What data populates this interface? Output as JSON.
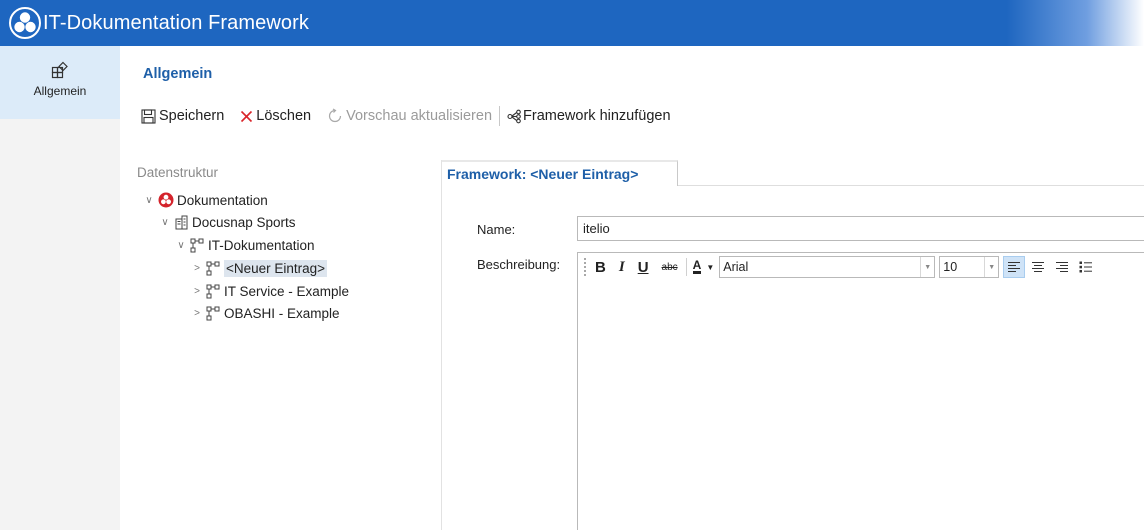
{
  "window": {
    "title": "IT-Dokumentation Framework"
  },
  "rail": {
    "items": [
      {
        "label": "Allgemein",
        "icon": "grid-plus-icon"
      }
    ]
  },
  "page": {
    "title": "Allgemein"
  },
  "toolbar": {
    "save_label": "Speichern",
    "delete_label": "Löschen",
    "refresh_preview_label": "Vorschau aktualisieren",
    "add_framework_label": "Framework hinzufügen"
  },
  "tree": {
    "header": "Datenstruktur",
    "root": "Dokumentation",
    "company": "Docusnap Sports",
    "folder": "IT-Dokumentation",
    "items": [
      "<Neuer Eintrag>",
      "IT Service - Example",
      "OBASHI - Example"
    ]
  },
  "tab": {
    "prefix": "Framework:",
    "name": "<Neuer Eintrag>"
  },
  "form": {
    "name_label": "Name:",
    "name_value": "itelio",
    "description_label": "Beschreibung:"
  },
  "editor": {
    "bold": "B",
    "italic": "I",
    "underline": "U",
    "strike": "abc",
    "font_color": "A",
    "font_family": "Arial",
    "font_size": "10"
  },
  "colors": {
    "titlebar": "#1e66c0",
    "accent_text": "#1e5fa8",
    "rail_selected": "#dcebf9",
    "delete_red": "#d9252a",
    "logo_red": "#d4232b"
  }
}
